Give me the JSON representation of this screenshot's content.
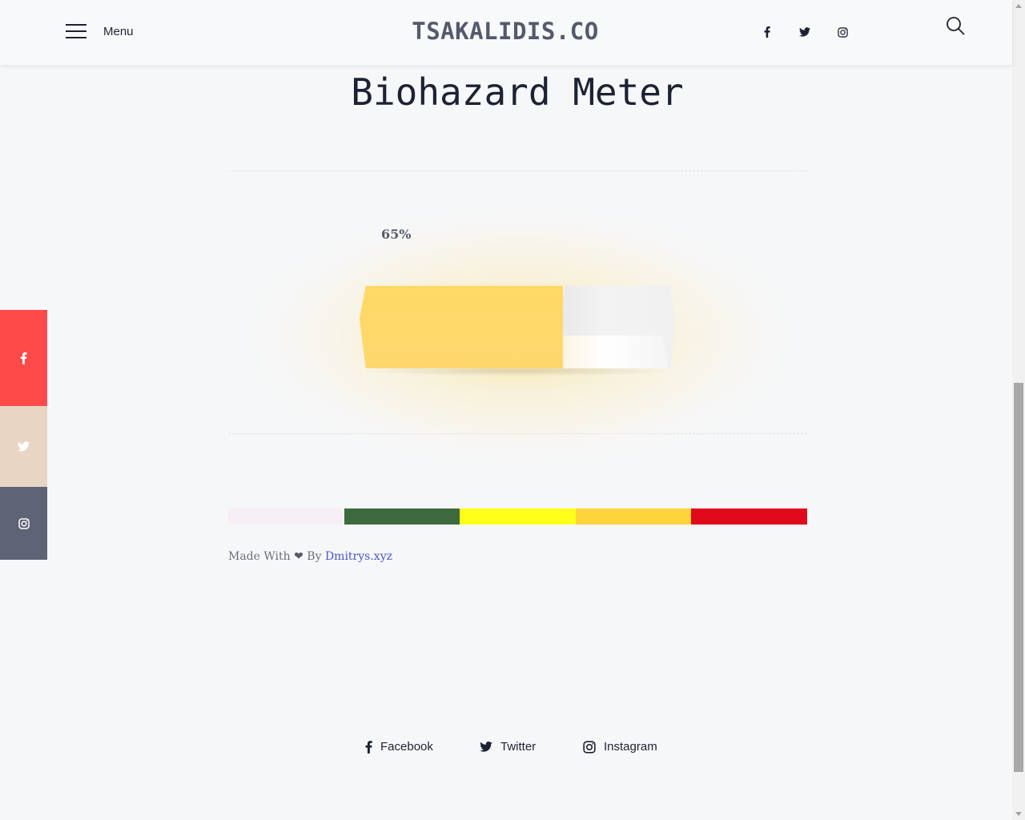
{
  "header": {
    "menu_label": "Menu",
    "brand": "TSAKALIDIS.CO",
    "social_icons": [
      "facebook-icon",
      "twitter-icon",
      "instagram-icon"
    ]
  },
  "side_social": [
    {
      "icon": "facebook-icon",
      "color": "#ff4a4a"
    },
    {
      "icon": "twitter-icon",
      "color": "#e8d5c4"
    },
    {
      "icon": "instagram-icon",
      "color": "#5e6375"
    }
  ],
  "main": {
    "title": "Biohazard Meter",
    "meter": {
      "percent_label": "65%",
      "level": 0.65,
      "fill_color": "#ffd964"
    },
    "scale_colors": [
      "#f6eff6",
      "#3d6a3f",
      "#ffff1a",
      "#ffd43b",
      "#e0081b"
    ],
    "credit": {
      "prefix": "Made With",
      "by": "By",
      "link": "Dmitrys.xyz"
    }
  },
  "footer": {
    "facebook": "Facebook",
    "twitter": "Twitter",
    "instagram": "Instagram"
  }
}
